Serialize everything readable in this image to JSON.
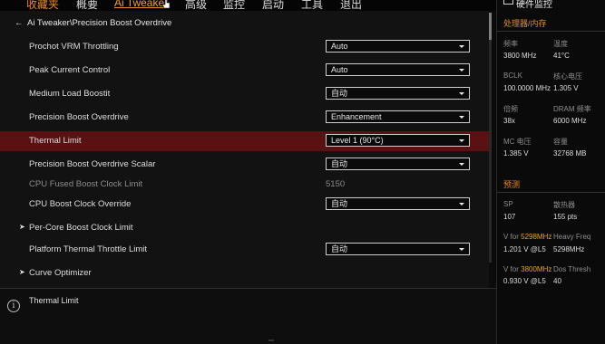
{
  "nav": {
    "tabs": [
      {
        "label": "收藏夹"
      },
      {
        "label": "概要"
      },
      {
        "label": "Ai Tweaker"
      },
      {
        "label": "高级"
      },
      {
        "label": "监控"
      },
      {
        "label": "启动"
      },
      {
        "label": "工具"
      },
      {
        "label": "退出"
      }
    ]
  },
  "breadcrumb": "Ai Tweaker\\Precision Boost Overdrive",
  "settings": [
    {
      "label": "Prochot VRM Throttling",
      "value": "Auto"
    },
    {
      "label": "Peak Current Control",
      "value": "Auto"
    },
    {
      "label": "Medium Load Boostit",
      "value": "自动"
    },
    {
      "label": "Precision Boost Overdrive",
      "value": "Enhancement"
    },
    {
      "label": "Thermal Limit",
      "value": "Level 1 (90°C)"
    },
    {
      "label": "Precision Boost Overdrive Scalar",
      "value": "自动"
    },
    {
      "label": "CPU Fused Boost Clock Limit",
      "value": "5150"
    },
    {
      "label": "CPU Boost Clock Override",
      "value": "自动"
    },
    {
      "label": "Per-Core Boost Clock Limit"
    },
    {
      "label": "Platform Thermal Throttle Limit",
      "value": "自动"
    },
    {
      "label": "Curve Optimizer"
    }
  ],
  "help": {
    "text": "Thermal Limit",
    "info_icon": "info-icon",
    "info_glyph": "i"
  },
  "panel": {
    "title": "硬件监控",
    "section_cpu": "处理器/内存",
    "cpu": [
      {
        "k": "频率",
        "v": "3800 MHz"
      },
      {
        "k": "温度",
        "v": "41°C"
      },
      {
        "k": "BCLK",
        "v": "100.0000 MHz"
      },
      {
        "k": "核心电压",
        "v": "1.305 V"
      },
      {
        "k": "倍频",
        "v": "38x"
      },
      {
        "k": "DRAM 频率",
        "v": "6000 MHz"
      },
      {
        "k": "MC 电压",
        "v": "1.385 V"
      },
      {
        "k": "容量",
        "v": "32768 MB"
      }
    ],
    "section_pred": "预测",
    "pred": {
      "sp_k": "SP",
      "sp_v": "107",
      "cooler_k": "散热器",
      "cooler_v": "155 pts",
      "vfor1_prefix": "V for ",
      "vfor1_freq": "5298MHz",
      "vfor1_v": "1.201 V @L5",
      "heavy_k": "Heavy Freq",
      "heavy_v": "5298MHz",
      "vfor2_prefix": "V for ",
      "vfor2_freq": "3800MHz",
      "vfor2_v": "0.930 V @L5",
      "dos_k": "Dos Thresh",
      "dos_v": "40"
    }
  },
  "colors": {
    "accent": "#e8892c",
    "highlight_row": "#5a1111"
  }
}
